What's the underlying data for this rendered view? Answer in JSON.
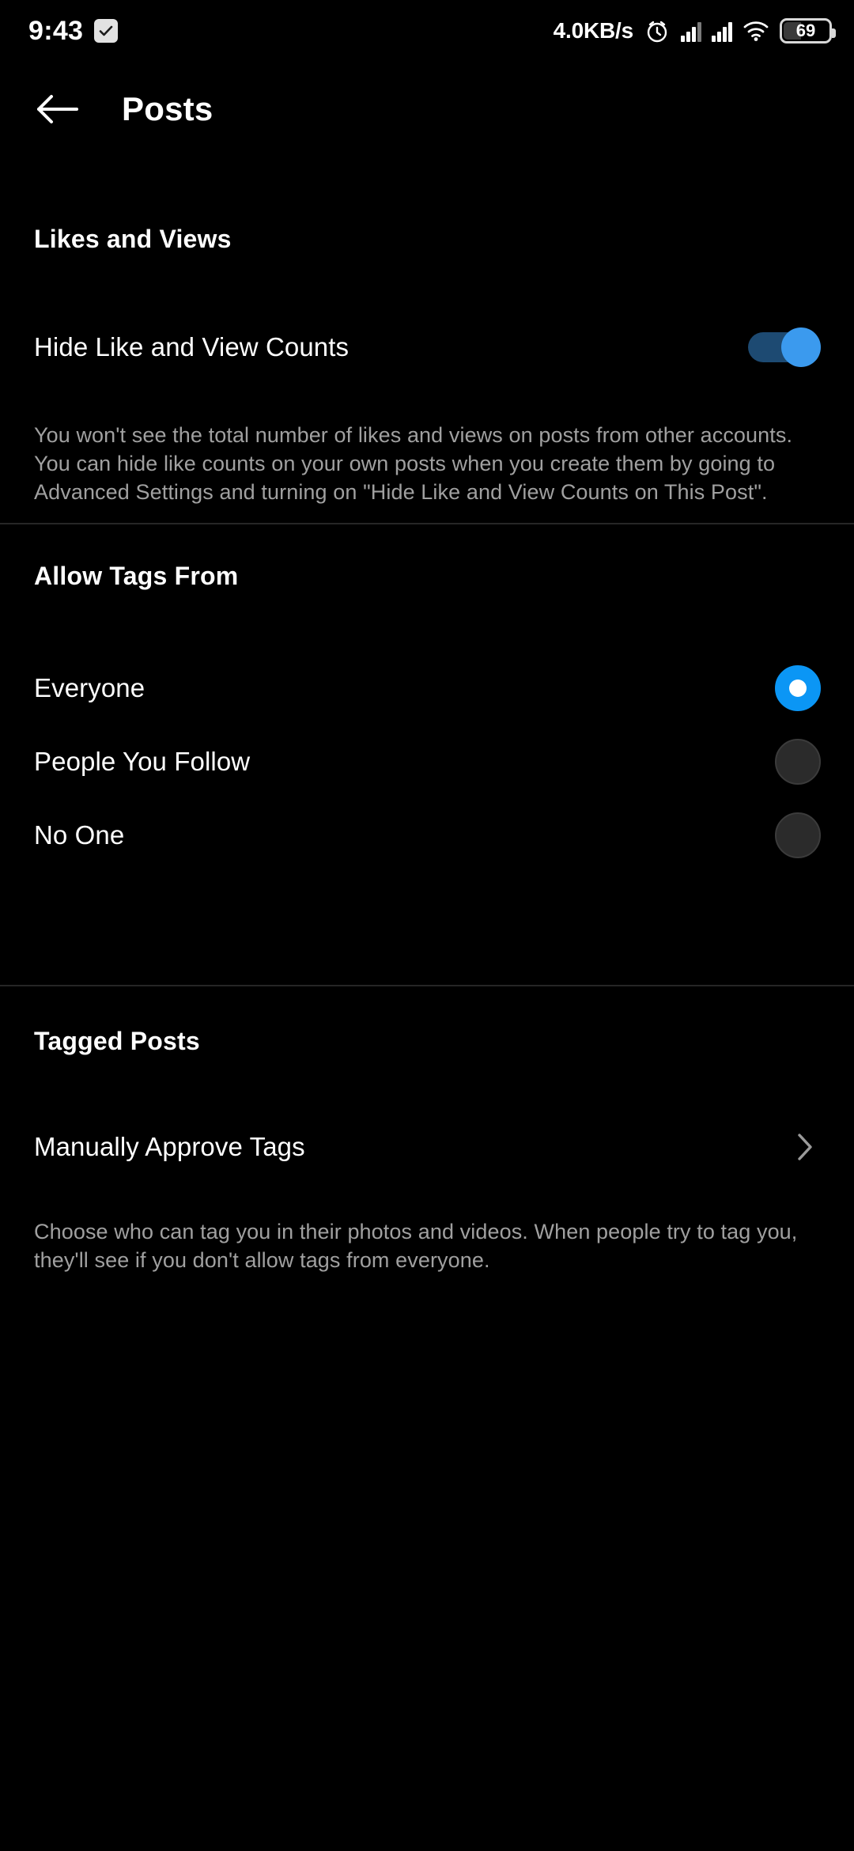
{
  "status_bar": {
    "time": "9:43",
    "checkbox_icon": "checkmark-badge-icon",
    "network_speed": "4.0KB/s",
    "alarm_icon": "alarm-clock-icon",
    "signal1_icon": "cellular-signal-icon",
    "signal2_icon": "cellular-signal-icon",
    "wifi_icon": "wifi-icon",
    "battery_level": "69",
    "battery_icon": "battery-icon"
  },
  "header": {
    "back_icon": "arrow-left-icon",
    "title": "Posts"
  },
  "likes_section": {
    "title": "Likes and Views",
    "row_label": "Hide Like and View Counts",
    "toggle_on": true,
    "description": "You won't see the total number of likes and views on posts from other accounts. You can hide like counts on your own posts when you create them by going to Advanced Settings and turning on \"Hide Like and View Counts on This Post\"."
  },
  "tags_section": {
    "title": "Allow Tags From",
    "options": [
      {
        "label": "Everyone",
        "selected": true
      },
      {
        "label": "People You Follow",
        "selected": false
      },
      {
        "label": "No One",
        "selected": false
      }
    ]
  },
  "tagged_posts_section": {
    "title": "Tagged Posts",
    "row_label": "Manually Approve Tags",
    "chevron_icon": "chevron-right-icon",
    "description": "Choose who can tag you in their photos and videos. When people try to tag you, they'll see if you don't allow tags from everyone."
  },
  "colors": {
    "background": "#000000",
    "accent_blue": "#0b96f5",
    "toggle_thumb": "#3b9aee",
    "toggle_track": "#1d4a72",
    "text_primary": "#ffffff",
    "text_secondary": "#a0a0a0",
    "divider": "#262626"
  }
}
